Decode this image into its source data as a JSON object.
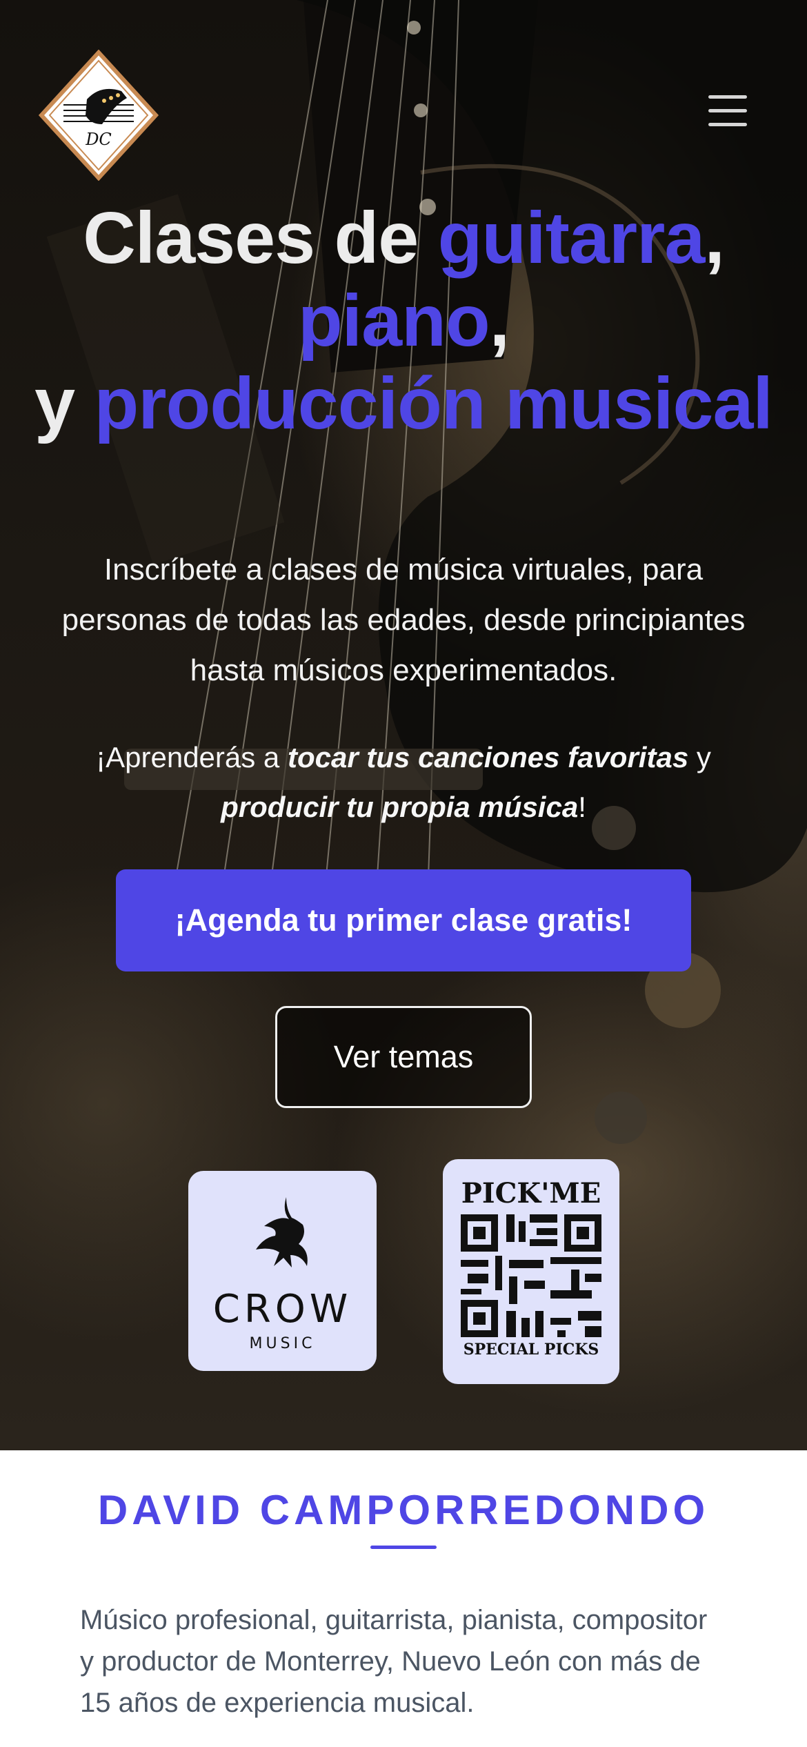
{
  "header": {
    "logo_text": "DC",
    "menu_icon": "hamburger-menu-icon"
  },
  "hero": {
    "title": {
      "p1": "Clases de ",
      "p2": "guitarra",
      "p3": ",",
      "p4": "piano",
      "p5": ",",
      "p6": "y ",
      "p7": "producción musical"
    },
    "intro": "Inscríbete a clases de música virtuales, para personas de todas las edades, desde principiantes hasta músicos experimentados.",
    "learn": {
      "t1": "¡Aprenderás a ",
      "t2": "tocar tus canciones favoritas",
      "t3": " y ",
      "t4": "producir tu propia música",
      "t5": "!"
    },
    "cta_label": "¡Agenda tu primer clase gratis!",
    "topics_label": "Ver temas"
  },
  "sponsors": {
    "crow": {
      "name": "CROW",
      "sub": "MUSIC"
    },
    "pick": {
      "top": "PICK'ME",
      "bottom": "SPECIAL PICKS"
    }
  },
  "about": {
    "name": "DAVID CAMPORREDONDO",
    "bio": "Músico profesional, guitarrista, pianista, compositor y productor de Monterrey, Nuevo León con más de 15 años de experiencia musical."
  },
  "colors": {
    "accent": "#4f46e5",
    "sponsor_bg": "#e0e2fb",
    "logo_ring": "#c88a52"
  }
}
